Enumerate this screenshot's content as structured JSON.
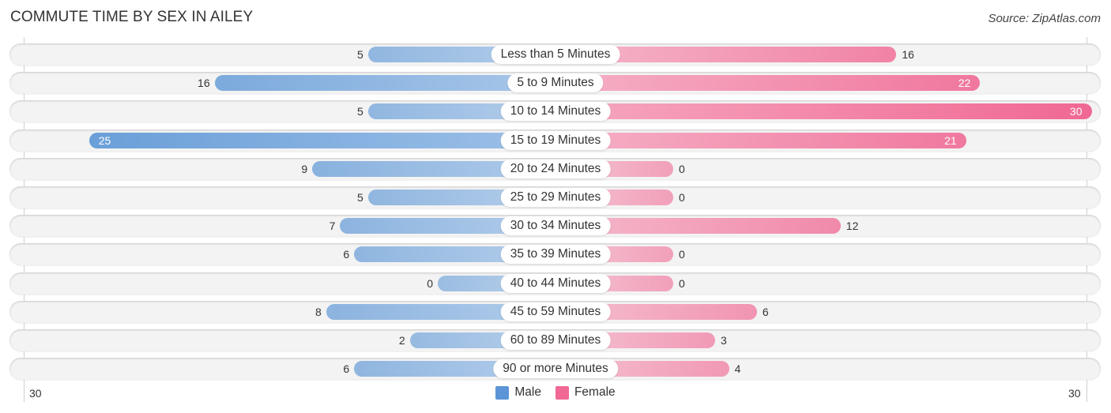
{
  "header": {
    "title": "COMMUTE TIME BY SEX IN AILEY",
    "source": "Source: ZipAtlas.com"
  },
  "colors": {
    "male": "#6a9fd8",
    "female": "#f06893"
  },
  "chart_data": {
    "type": "bar",
    "orientation": "horizontal-diverging",
    "title": "COMMUTE TIME BY SEX IN AILEY",
    "categories": [
      "Less than 5 Minutes",
      "5 to 9 Minutes",
      "10 to 14 Minutes",
      "15 to 19 Minutes",
      "20 to 24 Minutes",
      "25 to 29 Minutes",
      "30 to 34 Minutes",
      "35 to 39 Minutes",
      "40 to 44 Minutes",
      "45 to 59 Minutes",
      "60 to 89 Minutes",
      "90 or more Minutes"
    ],
    "series": [
      {
        "name": "Male",
        "values": [
          5,
          16,
          5,
          25,
          9,
          5,
          7,
          6,
          0,
          8,
          2,
          6
        ]
      },
      {
        "name": "Female",
        "values": [
          16,
          22,
          30,
          21,
          0,
          0,
          12,
          0,
          0,
          6,
          3,
          4
        ]
      }
    ],
    "axis": {
      "left_label": "30",
      "right_label": "30",
      "range": [
        -30,
        30
      ]
    },
    "legend": {
      "position": "bottom-center",
      "entries": [
        "Male",
        "Female"
      ]
    },
    "grid": false
  }
}
